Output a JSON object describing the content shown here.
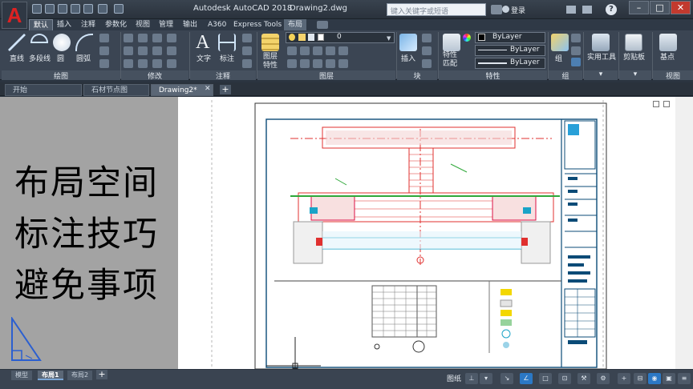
{
  "titlebar": {
    "app_title": "Autodesk AutoCAD 2018",
    "document_name": "Drawing2.dwg",
    "search_placeholder": "键入关键字或短语",
    "login_label": "登录",
    "help_label": "?"
  },
  "ribbon_tabs": [
    "默认",
    "插入",
    "注释",
    "参数化",
    "视图",
    "管理",
    "输出",
    "A360",
    "Express Tools",
    "布局"
  ],
  "ribbon": {
    "draw": {
      "line": "直线",
      "polyline": "多段线",
      "circle": "圆",
      "arc": "圆弧",
      "panel": "绘图"
    },
    "modify": {
      "panel": "修改"
    },
    "annotation": {
      "text": "文字",
      "dimension": "标注",
      "panel": "注释"
    },
    "layers": {
      "properties": "图层特性",
      "current_layer": "0",
      "panel": "图层"
    },
    "block": {
      "insert": "插入",
      "panel": "块"
    },
    "properties": {
      "match": "特性匹配",
      "color": "ByLayer",
      "linetype": "ByLayer",
      "lineweight": "ByLayer",
      "panel": "特性"
    },
    "groups": {
      "group": "组",
      "panel": "组"
    },
    "utilities": {
      "label": "实用工具"
    },
    "clipboard": {
      "label": "剪贴板"
    },
    "view": {
      "base": "基点",
      "panel": "视图"
    }
  },
  "doc_tabs": [
    "开始",
    "石材节点图_t3*",
    "Drawing2*"
  ],
  "overlay_text": [
    "布局空间",
    "标注技巧",
    "避免事项"
  ],
  "layout_tabs": [
    "模型",
    "布局1",
    "布局2"
  ],
  "statusbar": {
    "paper": "图纸"
  },
  "colors": {
    "accent": "#2b78c5",
    "drawing_red": "#e0302f",
    "drawing_green": "#2fa83a",
    "drawing_cyan": "#1aa3c7"
  }
}
